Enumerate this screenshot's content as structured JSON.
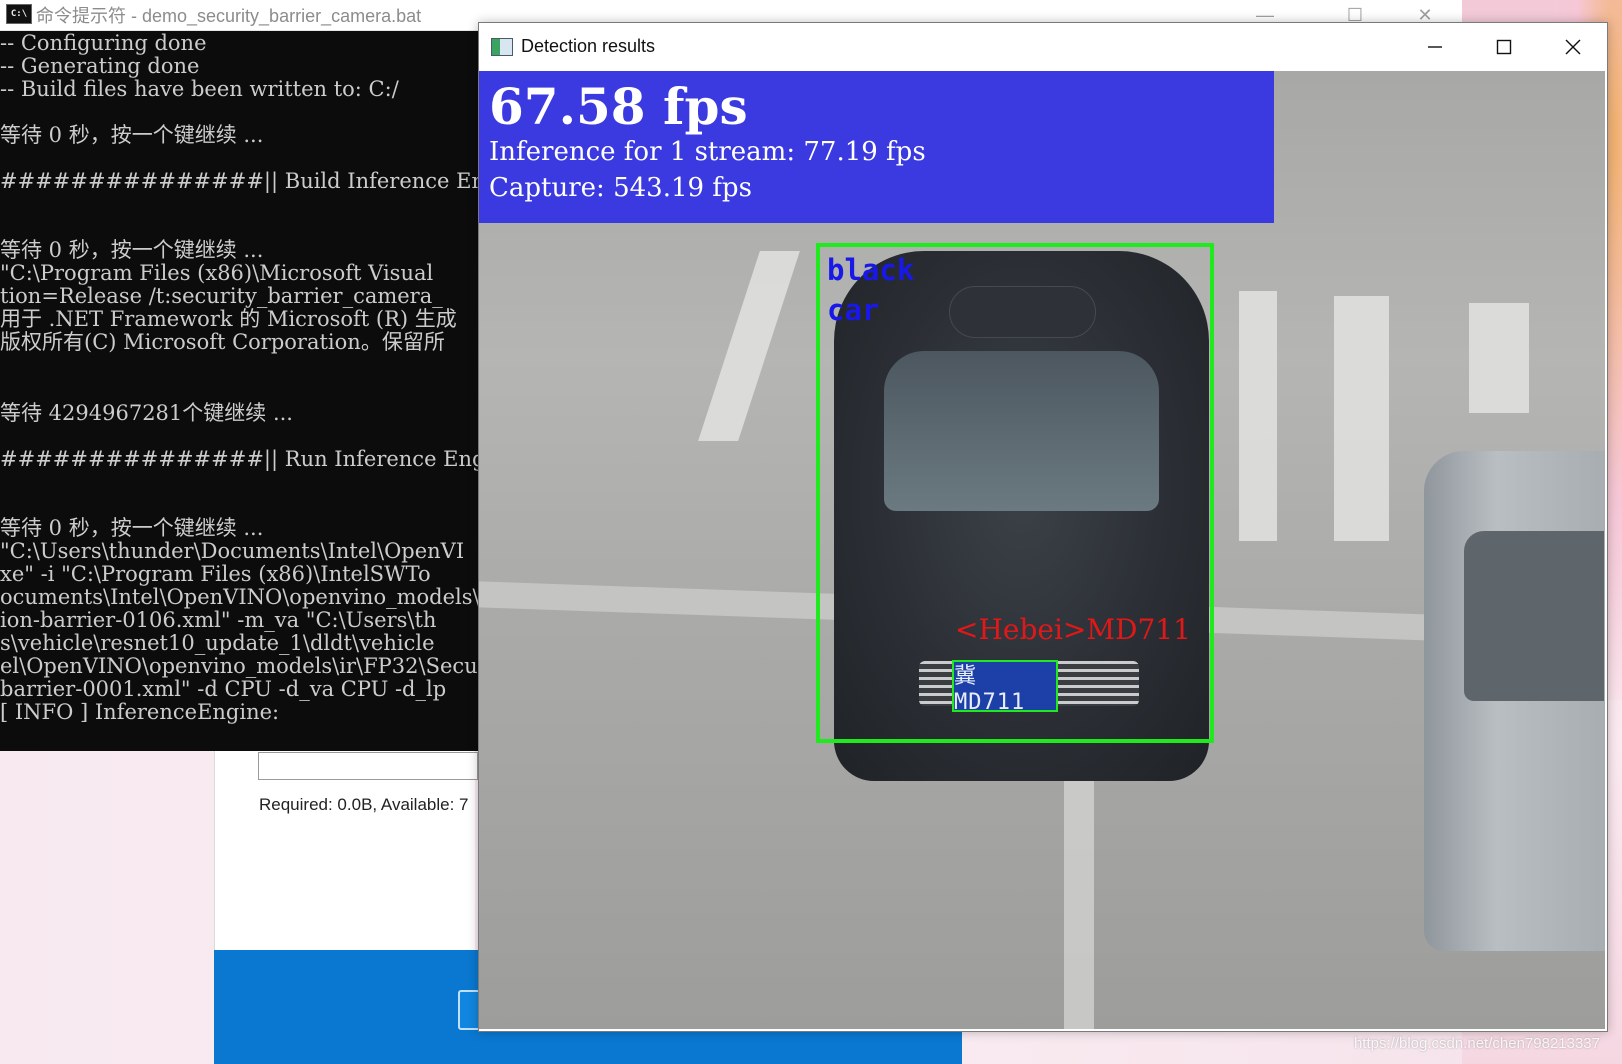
{
  "cmd_window": {
    "title": "命令提示符 - demo_security_barrier_camera.bat",
    "icon": "C:\\",
    "controls": {
      "minimize": "—",
      "maximize": "☐",
      "close": "✕"
    },
    "lines": [
      "-- Configuring done",
      "-- Generating done",
      "-- Build files have been written to: C:/",
      "",
      "等待 0 秒，按一个键继续 ...",
      "",
      "###############|| Build Inference Engine",
      "",
      "",
      "等待 0 秒，按一个键继续 ...",
      "\"C:\\Program Files (x86)\\Microsoft Visual",
      "tion=Release /t:security_barrier_camera_",
      "用于 .NET Framework 的 Microsoft (R) 生成",
      "版权所有(C) Microsoft Corporation。保留所",
      "",
      "",
      "等待 4294967281个键继续 ...",
      "",
      "###############|| Run Inference Engine s",
      "",
      "",
      "等待 0 秒，按一个键继续 ...",
      "\"C:\\Users\\thunder\\Documents\\Intel\\OpenVI",
      "xe\" -i \"C:\\Program Files (x86)\\IntelSWTo",
      "ocuments\\Intel\\OpenVINO\\openvino_models\\",
      "ion-barrier-0106.xml\" -m_va \"C:\\Users\\th",
      "s\\vehicle\\resnet10_update_1\\dldt\\vehicle",
      "el\\OpenVINO\\openvino_models\\ir\\FP32\\Secu",
      "barrier-0001.xml\" -d CPU -d_va CPU -d_lp",
      "[ INFO ] InferenceEngine:"
    ]
  },
  "installer": {
    "required_text": "Required: 0.0B, Available:  7"
  },
  "detection_window": {
    "title": "Detection results",
    "controls": {
      "minimize": "minimize",
      "maximize": "maximize",
      "close": "close"
    },
    "stats": {
      "fps": "67.58 fps",
      "inference": "Inference for 1 stream: 77.19 fps",
      "capture": "Capture: 543.19 fps"
    },
    "vehicle": {
      "attr_line1": "black",
      "attr_line2": "car"
    },
    "plate": {
      "label": "<Hebei>MD711",
      "plate_text": "冀 MD711"
    },
    "colors": {
      "box": "#1eea1e",
      "stats_bg": "#3a3ae0",
      "attr": "#1818e8",
      "plate_label": "#e01818"
    }
  },
  "watermark": "https://blog.csdn.net/chen798213337"
}
